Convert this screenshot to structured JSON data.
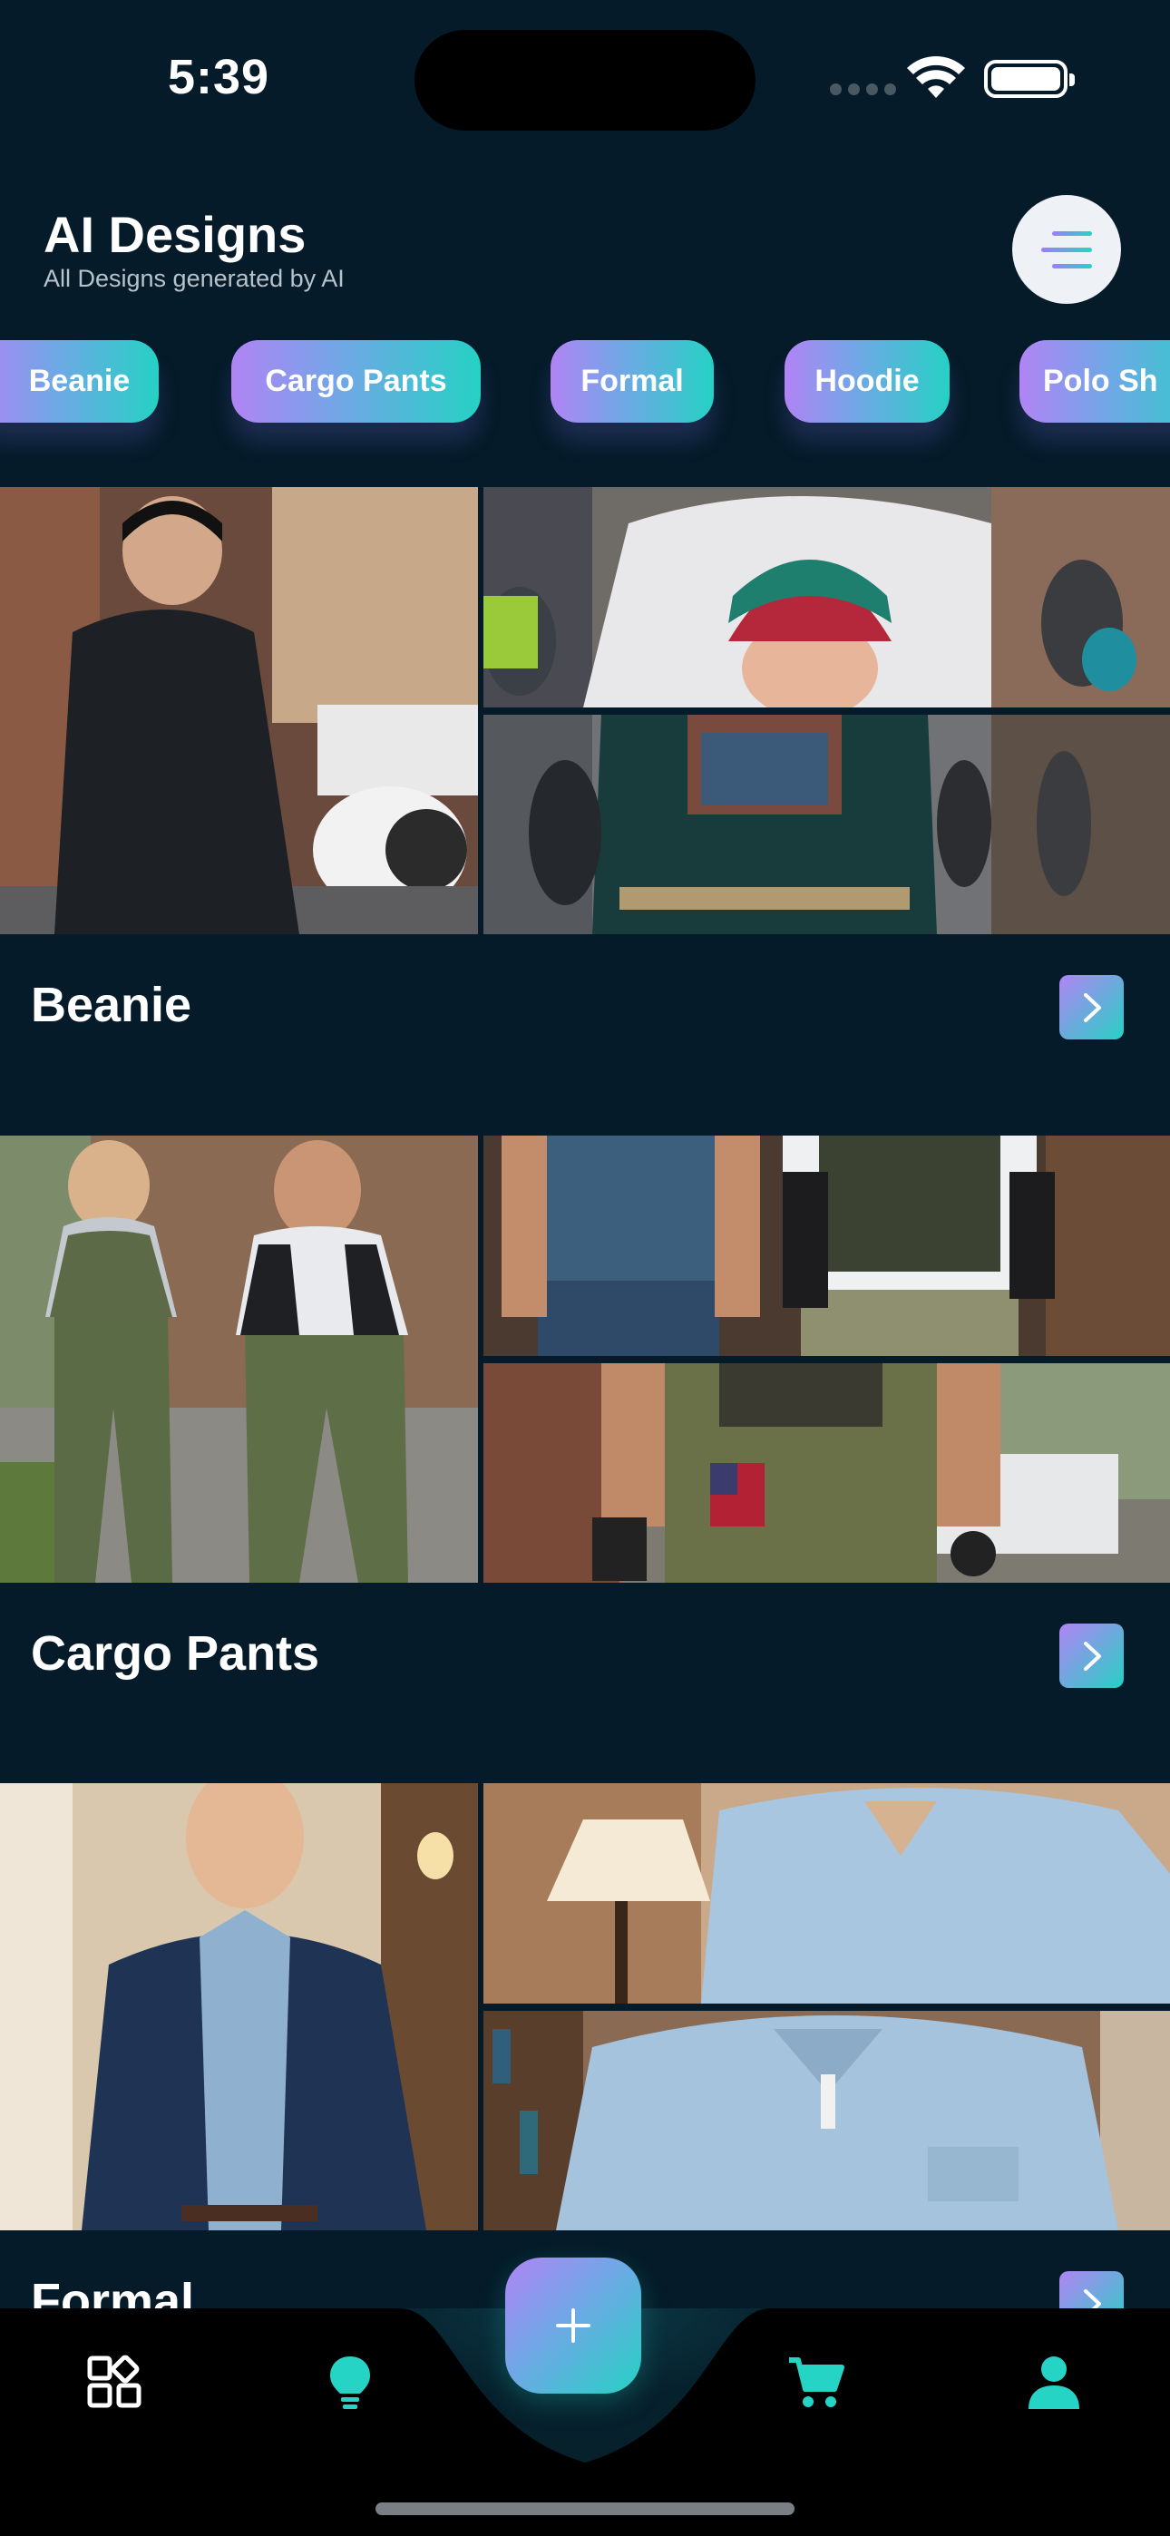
{
  "status_bar": {
    "time": "5:39"
  },
  "header": {
    "title": "AI Designs",
    "subtitle": "All Designs generated by AI"
  },
  "chips": [
    "Beanie",
    "Cargo Pants",
    "Formal",
    "Hoodie",
    "Polo Sh"
  ],
  "cards": [
    {
      "title": "Beanie"
    },
    {
      "title": "Cargo Pants"
    },
    {
      "title": "Formal"
    }
  ],
  "icons": {
    "menu": "menu-icon",
    "arrow": "chevron-right-icon",
    "tabs": [
      "grid-icon",
      "lightbulb-icon",
      "plus-icon",
      "cart-icon",
      "user-icon"
    ]
  },
  "colors": {
    "background": "#051b29",
    "accent_start": "#b184f5",
    "accent_end": "#25d1c4",
    "tab_icon": "#26d4c6"
  }
}
